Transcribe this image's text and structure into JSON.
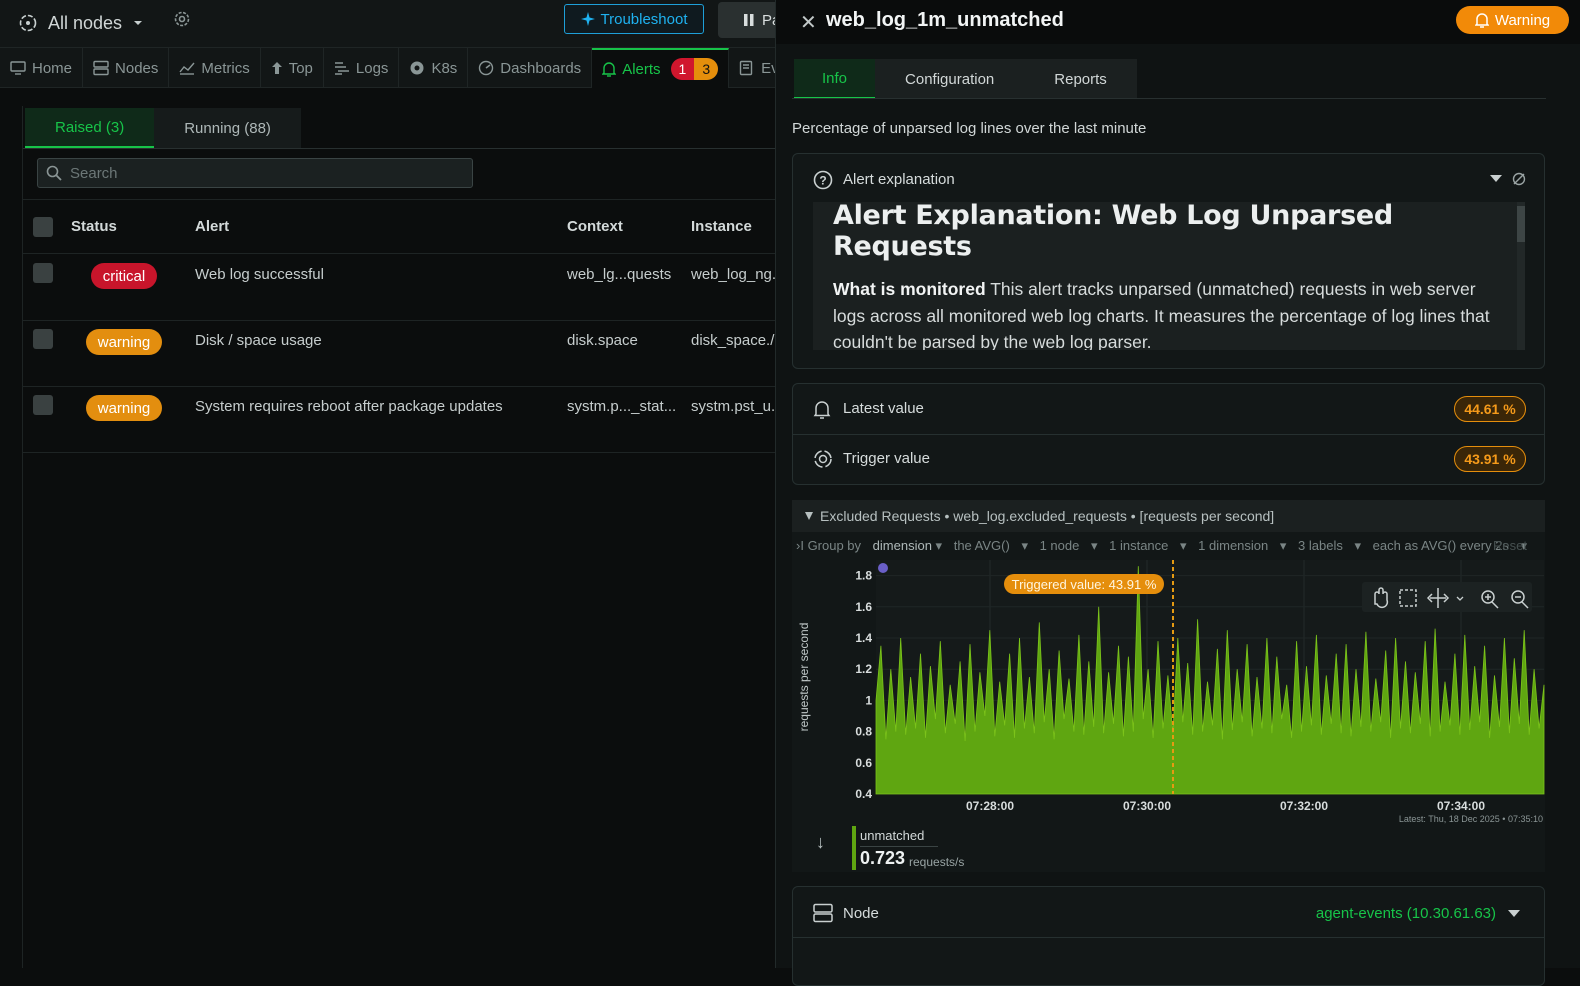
{
  "topbar": {
    "nodes_label": "All nodes",
    "troubleshoot_label": "Troubleshoot",
    "pause_label": "Pa"
  },
  "nav": {
    "items": [
      {
        "label": "Home",
        "icon": "monitor-icon"
      },
      {
        "label": "Nodes",
        "icon": "server-icon"
      },
      {
        "label": "Metrics",
        "icon": "metrics-icon"
      },
      {
        "label": "Top",
        "icon": "arrow-up-icon"
      },
      {
        "label": "Logs",
        "icon": "logs-icon"
      },
      {
        "label": "K8s",
        "icon": "k8s-icon"
      },
      {
        "label": "Dashboards",
        "icon": "gauge-icon"
      },
      {
        "label": "Alerts",
        "icon": "bell-icon",
        "critical_count": "1",
        "warning_count": "3"
      },
      {
        "label": "Ev",
        "icon": "events-icon"
      }
    ]
  },
  "alerts_list": {
    "tabs": [
      "Raised (3)",
      "Running (88)"
    ],
    "search_placeholder": "Search",
    "columns": [
      "Status",
      "Alert",
      "Context",
      "Instance"
    ],
    "rows": [
      {
        "status": "critical",
        "alert": "Web log successful",
        "context": "web_lg...quests",
        "instance": "web_log_ng..."
      },
      {
        "status": "warning",
        "alert": "Disk / space usage",
        "context": "disk.space",
        "instance": "disk_space./"
      },
      {
        "status": "warning",
        "alert": "System requires reboot after package updates",
        "context": "systm.p..._stat...",
        "instance": "systm.pst_u..."
      }
    ]
  },
  "panel": {
    "title": "web_log_1m_unmatched",
    "status_label": "Warning",
    "tabs": [
      "Info",
      "Configuration",
      "Reports"
    ],
    "description": "Percentage of unparsed log lines over the last minute",
    "explanation": {
      "label": "Alert explanation",
      "heading": "Alert Explanation: Web Log Unparsed Requests",
      "monitored_label": "What is monitored",
      "monitored_text": "This alert tracks unparsed (unmatched) requests in web server logs across all monitored web log charts. It measures the percentage of log lines that couldn't be parsed by the web log parser."
    },
    "latest_value": {
      "label": "Latest value",
      "value": "44.61 %"
    },
    "trigger_value": {
      "label": "Trigger value",
      "value": "43.91 %"
    },
    "chart_header": {
      "title": "Excluded Requests • web_log.excluded_requests • [requests per second]",
      "group_by_label": "Group by",
      "group_by_value": "dimension",
      "agg": "the AVG()",
      "nodes": "1 node",
      "instances": "1 instance",
      "dimensions": "1 dimension",
      "labels": "3 labels",
      "each_as": "each as AVG() every 2s",
      "reset": "Reset",
      "triggered_label": "Triggered value: 43.91 %",
      "latest": "Latest:  Thu, 18 Dec 2025 • 07:35:10"
    },
    "legend": {
      "name": "unmatched",
      "value": "0.723",
      "unit": "requests/s"
    },
    "node": {
      "label": "Node",
      "value": "agent-events (10.30.61.63)"
    }
  },
  "colors": {
    "accent_green": "#17c449",
    "critical": "#c8152b",
    "warning": "#e38e0f",
    "series": "#5fa611",
    "trigger_line": "#e59a12",
    "troubleshoot": "#1fb2f0"
  },
  "chart_data": {
    "type": "area",
    "title": "Excluded Requests",
    "ylabel": "requests per second",
    "ylim": [
      0.4,
      1.9
    ],
    "y_ticks": [
      "1.8",
      "1.6",
      "1.4",
      "1.2",
      "1",
      "0.8",
      "0.6",
      "0.4"
    ],
    "x_ticks": [
      "07:28:00",
      "07:30:00",
      "07:32:00",
      "07:34:00"
    ],
    "trigger_time": "07:30:20",
    "series": [
      {
        "name": "unmatched",
        "values": [
          1.0,
          1.35,
          0.75,
          1.2,
          0.8,
          1.4,
          0.78,
          1.15,
          0.82,
          1.3,
          0.76,
          1.22,
          0.88,
          1.38,
          0.79,
          1.1,
          0.85,
          1.25,
          0.74,
          1.36,
          0.8,
          1.18,
          0.9,
          1.45,
          0.77,
          1.12,
          0.84,
          1.3,
          0.76,
          1.4,
          0.82,
          1.15,
          0.79,
          1.5,
          0.86,
          1.2,
          0.75,
          1.32,
          0.88,
          1.14,
          0.8,
          1.42,
          0.78,
          1.25,
          0.83,
          1.6,
          0.79,
          1.18,
          0.85,
          1.35,
          0.77,
          1.28,
          0.8,
          1.86,
          0.88,
          1.2,
          0.76,
          1.38,
          0.82,
          1.16,
          0.79,
          1.4,
          0.86,
          1.24,
          0.78,
          1.52,
          0.8,
          1.12,
          0.84,
          1.33,
          0.75,
          1.45,
          0.81,
          1.2,
          0.86,
          1.36,
          0.77,
          1.15,
          0.82,
          1.4,
          0.79,
          1.28,
          0.88,
          1.1,
          0.76,
          1.38,
          0.8,
          1.22,
          0.84,
          1.42,
          0.78,
          1.16,
          0.85,
          1.3,
          0.79,
          1.36,
          0.77,
          1.2,
          0.83,
          1.44,
          0.8,
          1.14,
          0.86,
          1.32,
          0.76,
          1.4,
          0.82,
          1.25,
          0.79,
          1.18,
          0.85,
          1.38,
          0.77,
          1.46,
          0.8,
          1.12,
          0.84,
          1.3,
          0.78,
          1.42,
          0.81,
          1.22,
          0.86,
          1.35,
          0.76,
          1.16,
          0.83,
          1.4,
          0.79,
          1.27,
          0.85,
          1.45,
          0.78,
          1.2,
          0.82,
          1.1
        ]
      }
    ]
  }
}
